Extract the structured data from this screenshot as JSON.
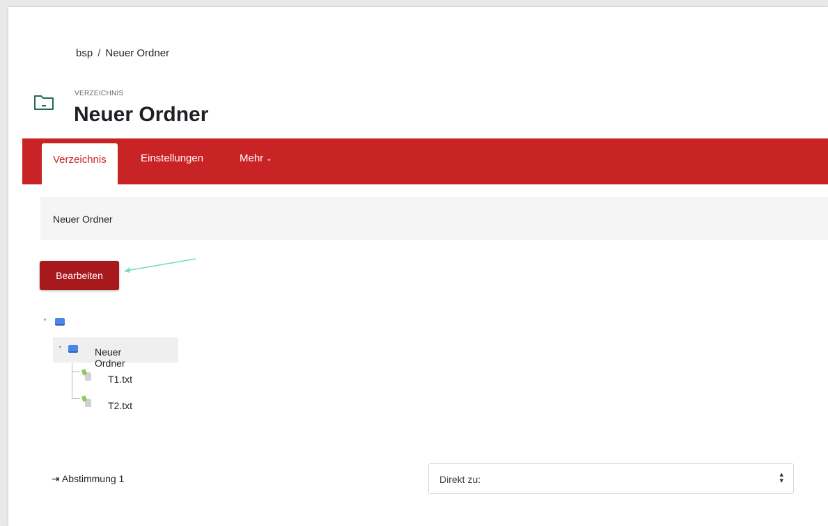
{
  "breadcrumb": {
    "items": [
      "bsp",
      "Neuer Ordner"
    ],
    "separator": "/"
  },
  "header": {
    "kind": "VERZEICHNIS",
    "title": "Neuer Ordner",
    "icon": "folder-icon"
  },
  "nav": {
    "tabs": [
      {
        "label": "Verzeichnis",
        "active": true
      },
      {
        "label": "Einstellungen",
        "active": false
      },
      {
        "label": "Mehr",
        "active": false
      }
    ],
    "more_caret": "⌄"
  },
  "content": {
    "path_label": "Neuer Ordner",
    "edit_button": "Bearbeiten"
  },
  "tree": {
    "root_toggle": "▼",
    "folder": {
      "name": "Neuer Ordner",
      "toggle": "▼"
    },
    "files": [
      "T1.txt",
      "T2.txt"
    ]
  },
  "footer": {
    "prev_arrow": "⇥",
    "prev_activity": "Abstimmung 1",
    "jump_label": "Direkt zu:",
    "jump_chevrons": "▴▾"
  },
  "colors": {
    "brand": "#c92425",
    "button": "#a8191d",
    "annotation_arrow": "#6fe0bd"
  }
}
